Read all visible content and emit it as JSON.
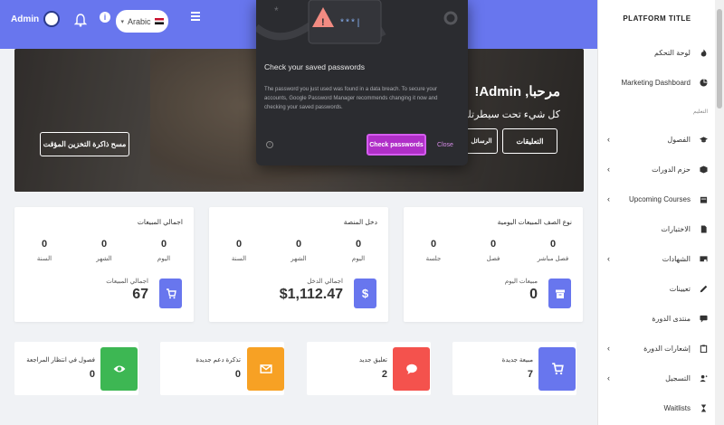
{
  "header": {
    "user_name": "Admin",
    "language": "Arabic"
  },
  "banner": {
    "welcome": "مرحبا, Admin!",
    "subtitle": "كل شيء تحت سيطرتك ، استمتع",
    "clear_cache_button": "مسح ذاكرة التخزين المؤقت",
    "comments_button": "التعليقات",
    "messages_button": "الرسائل"
  },
  "password_popup": {
    "title": "Check your saved passwords",
    "body": "The password you just used was found in a data breach. To secure your accounts, Google Password Manager recommends changing it now and checking your saved passwords.",
    "masked_password": "***|",
    "check_button": "Check passwords",
    "close_button": "Close"
  },
  "cards": {
    "sales": {
      "title": "اجمالي المبيعات",
      "values": [
        "0",
        "0",
        "0"
      ],
      "labels": [
        "اليوم",
        "الشهر",
        "السنة"
      ],
      "total_label": "اجمالي المبيعات",
      "total": "67"
    },
    "income": {
      "title": "دخل المنصة",
      "values": [
        "0",
        "0",
        "0"
      ],
      "labels": [
        "اليوم",
        "الشهر",
        "السنة"
      ],
      "total_label": "اجمالي الدخل",
      "total": "$1,112.47"
    },
    "daily_type": {
      "title": "نوع الصف المبيعات اليومية",
      "values": [
        "0",
        "0",
        "0"
      ],
      "labels": [
        "فصل مباشر",
        "فصل",
        "جلسة"
      ],
      "total_label": "مبيعات اليوم",
      "total": "0"
    }
  },
  "small_cards": [
    {
      "label": "مبيعة جديدة",
      "value": "7",
      "color": "#6876ee",
      "icon": "cart-icon"
    },
    {
      "label": "تعليق جديد",
      "value": "2",
      "color": "#f4524d",
      "icon": "comment-icon"
    },
    {
      "label": "تذكرة دعم جديدة",
      "value": "0",
      "color": "#f7a124",
      "icon": "envelope-icon"
    },
    {
      "label": "فصول في انتظار المراجعة",
      "value": "0",
      "color": "#3db753",
      "icon": "eye-icon"
    }
  ],
  "sidebar": {
    "title": "PLATFORM TITLE",
    "section_label": "التعليم",
    "items": [
      {
        "label": "لوحة التحكم",
        "icon": "fire-icon",
        "chevron": false
      },
      {
        "label": "Marketing Dashboard",
        "icon": "pie-icon",
        "chevron": false
      },
      {
        "label": "الفصول",
        "icon": "graduation-cap-icon",
        "chevron": true
      },
      {
        "label": "حزم الدورات",
        "icon": "box-icon",
        "chevron": true
      },
      {
        "label": "Upcoming Courses",
        "icon": "calendar-icon",
        "chevron": true
      },
      {
        "label": "الاختبارات",
        "icon": "file-icon",
        "chevron": false
      },
      {
        "label": "الشهادات",
        "icon": "certificate-icon",
        "chevron": true
      },
      {
        "label": "تعيينات",
        "icon": "pen-icon",
        "chevron": false
      },
      {
        "label": "منتدى الدورة",
        "icon": "chat-icon",
        "chevron": false
      },
      {
        "label": "إشعارات الدورة",
        "icon": "clipboard-icon",
        "chevron": true
      },
      {
        "label": "التسجيل",
        "icon": "user-plus-icon",
        "chevron": true
      },
      {
        "label": "Waitlists",
        "icon": "hourglass-icon",
        "chevron": false
      }
    ]
  },
  "colors": {
    "primary": "#6876ee",
    "popup_bg": "#2b2c30",
    "popup_button": "#b02fc8"
  }
}
